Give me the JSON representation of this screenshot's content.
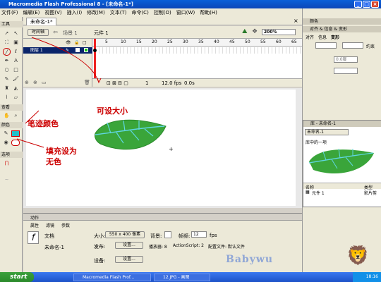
{
  "window": {
    "title": "Macromedia Flash Professional 8 - [未命名-1*]"
  },
  "menu": [
    "文件(F)",
    "编辑(E)",
    "视图(V)",
    "插入(I)",
    "修改(M)",
    "文本(T)",
    "命令(C)",
    "控制(O)",
    "窗口(W)",
    "帮助(H)"
  ],
  "tools": {
    "title": "工具",
    "view_title": "查看",
    "color_title": "颜色",
    "options_title": "选项"
  },
  "document": {
    "tab": "未命名-1*",
    "timeline_btn": "时间轴",
    "scene": "场景 1",
    "symbol": "元件 1",
    "zoom": "200%"
  },
  "timeline": {
    "layer_name": "图层 1",
    "frame_numbers": [
      "5",
      "10",
      "15",
      "20",
      "25",
      "30",
      "35",
      "40",
      "45",
      "50",
      "55",
      "60",
      "65"
    ],
    "current_frame": "1",
    "fps": "12.0 fps",
    "time": "0.0s"
  },
  "actions_label": "动作",
  "properties": {
    "tabs": [
      "属性",
      "滤镜",
      "参数"
    ],
    "doc_label": "文档",
    "doc_name": "未命名-1",
    "size_label": "大小:",
    "size_value": "550 x 400 像素",
    "bg_label": "背景:",
    "fps_label": "帧频:",
    "fps_value": "12",
    "fps_unit": "fps",
    "publish_label": "发布:",
    "settings_btn": "设置...",
    "player_label": "播放器: 8",
    "as_label": "ActionScript: 2",
    "profile_label": "配置文件: 默认文件",
    "device_label": "设备:",
    "device_btn": "设置..."
  },
  "right_panel": {
    "color_head": "颜色",
    "align_head": "对齐 & 信息 & 变形",
    "tabs": [
      "对齐",
      "信息",
      "变形"
    ],
    "constrain": "约束",
    "rotate_val": "0.0度",
    "library_head": "库 - 未命名-1",
    "library_doc": "未命名-1",
    "library_count": "库中的一项",
    "col_name": "名称",
    "col_type": "类型",
    "item_name": "元件 1",
    "item_type": "影片剪"
  },
  "annotations": {
    "stroke_color": "笔迹颜色",
    "size_adjustable": "可设大小",
    "fill_none": "填充设为无色"
  },
  "watermark": "Babywu",
  "taskbar": {
    "start": "start",
    "task1": "Macromedia Flash Prof...",
    "task2": "12.JPG - 画图",
    "clock": "18:16"
  },
  "colors": {
    "leaf": "#3aa53a",
    "vein": "#5fd6e0",
    "accent_red": "#cc0000"
  }
}
